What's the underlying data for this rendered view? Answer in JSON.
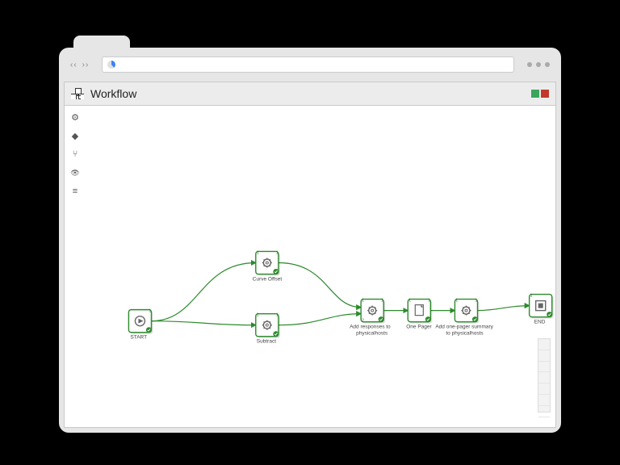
{
  "browser": {
    "back": "‹‹",
    "forward": "››"
  },
  "titlebar": {
    "title": "Workflow"
  },
  "toolbar": {
    "settings": "⚙",
    "diamond": "◆",
    "branch": "⑂",
    "eye": "👁",
    "sliders": "≡"
  },
  "nodes": {
    "start": {
      "label": "START",
      "p_out": "1"
    },
    "curve": {
      "label": "Curve Offset",
      "p_in": "1",
      "p_out": "1"
    },
    "subtract": {
      "label": "Subtract",
      "p_in": "1",
      "p_out": "1"
    },
    "addresp": {
      "label_l1": "Add responses to",
      "label_l2": "physicalhosts",
      "p_in1": "1",
      "p_in2": "2",
      "p_out": "1"
    },
    "onepager": {
      "label": "One Pager",
      "p_in": "1",
      "p_out": "1"
    },
    "addsum": {
      "label_l1": "Add one-pager summary",
      "label_l2": "to physicalhosts",
      "p_in": "1",
      "p_out": "1"
    },
    "end": {
      "label": "END",
      "p_in": "1"
    }
  },
  "colors": {
    "accent": "#2d8a2d",
    "status_ok": "#3ba55c",
    "status_err": "#c0392b"
  }
}
